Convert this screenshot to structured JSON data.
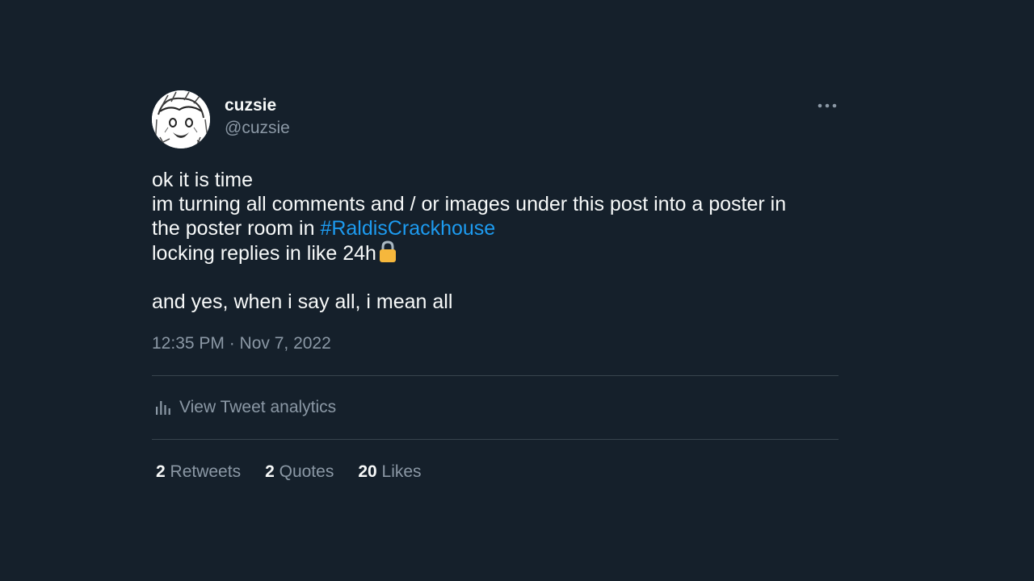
{
  "colors": {
    "background": "#15202b",
    "text": "#f7f9f9",
    "secondary": "#8b98a5",
    "link": "#1d9bf0",
    "divider": "#38444d",
    "lock": "#f6b73c"
  },
  "author": {
    "display_name": "cuzsie",
    "handle": "@cuzsie",
    "avatar_icon": "avatar-image",
    "more_icon": "more-options-icon"
  },
  "tweet": {
    "line1": "ok it is time",
    "line2": "im turning all comments and / or images under this post into a poster in",
    "line3_prefix": "the poster room in ",
    "hashtag": "#RaldisCrackhouse",
    "line4": "locking replies in like 24h",
    "line4_emoji_icon": "lock-icon",
    "line5": "and yes, when i say all, i mean all",
    "timestamp": "12:35 PM · Nov 7, 2022"
  },
  "analytics": {
    "icon": "analytics-icon",
    "label": "View Tweet analytics"
  },
  "stats": {
    "retweets": {
      "count": "2",
      "label": "Retweets"
    },
    "quotes": {
      "count": "2",
      "label": "Quotes"
    },
    "likes": {
      "count": "20",
      "label": "Likes"
    }
  }
}
